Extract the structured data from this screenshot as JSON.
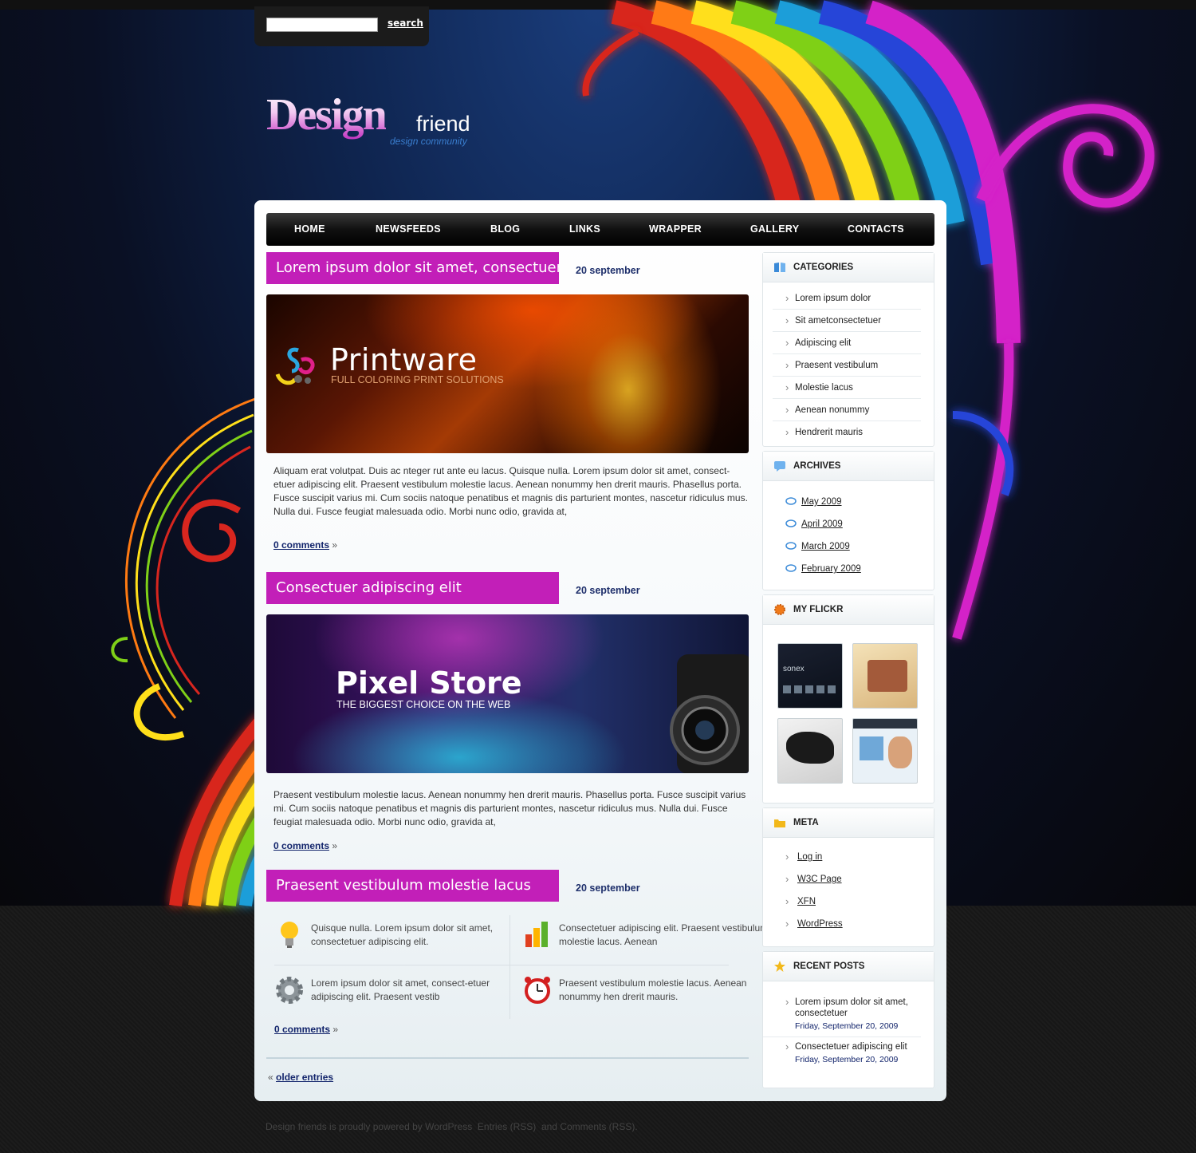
{
  "search": {
    "button_label": "search",
    "value": ""
  },
  "logo": {
    "main": "Design",
    "friend": "friend",
    "tagline": "design community"
  },
  "nav": [
    "HOME",
    "NEWSFEEDS",
    "BLOG",
    "LINKS",
    "WRAPPER",
    "GALLERY",
    "CONTACTS"
  ],
  "posts": [
    {
      "title": "Lorem ipsum dolor sit amet, consectuer",
      "date": "20 september",
      "banner": {
        "title": "Printware",
        "subtitle": "FULL COLORING PRINT SOLUTIONS"
      },
      "text": "Aliquam erat volutpat. Duis ac nteger rut ante eu lacus.  Quisque nulla.  Lorem ipsum dolor sit amet, consect-etuer adipiscing elit. Praesent vestibulum molestie lacus. Aenean nonummy hen drerit mauris. Phasellus porta. Fusce suscipit varius mi. Cum sociis natoque  penatibus et magnis dis parturient montes, nascetur ridiculus mus. Nulla dui. Fusce feugiat malesuada odio. Morbi nunc odio, gravida at,",
      "comments": "0 comments",
      "raquo": "»"
    },
    {
      "title": "Consectuer adipiscing elit",
      "date": "20 september",
      "banner": {
        "title": "Pixel Store",
        "subtitle": "THE BIGGEST CHOICE ON THE WEB"
      },
      "text": "Praesent vestibulum molestie lacus. Aenean nonummy hen drerit mauris. Phasellus porta. Fusce suscipit varius mi. Cum sociis natoque  penatibus et magnis dis parturient montes, nascetur ridiculus mus. Nulla dui. Fusce feugiat malesuada odio. Morbi nunc odio, gravida at,",
      "comments": "0 comments",
      "raquo": "»"
    },
    {
      "title": "Praesent vestibulum molestie lacus",
      "date": "20 september",
      "features": [
        {
          "icon": "lightbulb-icon",
          "text": "Quisque nulla.  Lorem ipsum dolor sit amet, consectetuer adipiscing elit."
        },
        {
          "icon": "bar-chart-icon",
          "text": "Consectetuer adipiscing elit. Praesent vestibulum molestie lacus. Aenean"
        },
        {
          "icon": "gear-icon",
          "text": "Lorem ipsum dolor sit amet, consect-etuer adipiscing elit. Praesent vestib"
        },
        {
          "icon": "alarm-clock-icon",
          "text": "Praesent vestibulum molestie lacus. Aenean nonummy hen drerit mauris."
        }
      ],
      "comments": "0 comments",
      "raquo": "»"
    }
  ],
  "older_entries": {
    "laquo": "«",
    "label": "older entries"
  },
  "sidebar": {
    "categories": {
      "title": "CATEGORIES",
      "items": [
        "Lorem ipsum dolor",
        "Sit ametconsectetuer",
        "Adipiscing elit",
        "Praesent vestibulum",
        "Molestie lacus",
        "Aenean nonummy",
        "Hendrerit mauris"
      ]
    },
    "archives": {
      "title": "ARCHIVES",
      "items": [
        "May 2009",
        "April 2009",
        "March 2009",
        "February 2009"
      ]
    },
    "flickr": {
      "title": "MY FLICKR",
      "thumb_label": "sonex"
    },
    "meta": {
      "title": "META",
      "items": [
        "Log in",
        "W3C Page",
        "XFN",
        "WordPress"
      ]
    },
    "recent": {
      "title": "RECENT POSTS",
      "items": [
        {
          "title": "Lorem ipsum dolor sit amet, consectetuer",
          "date": "Friday, September 20, 2009"
        },
        {
          "title": "Consectetuer adipiscing elit",
          "date": "Friday, September 20, 2009"
        }
      ]
    }
  },
  "footer": {
    "text": "Design friends is proudly powered by WordPress",
    "entries_rss": "Entries (RSS)",
    "and": "and",
    "comments_rss": "Comments (RSS)."
  },
  "colors": {
    "accent": "#c21fb8",
    "link": "#12246b",
    "nav_bg": "#000000"
  }
}
